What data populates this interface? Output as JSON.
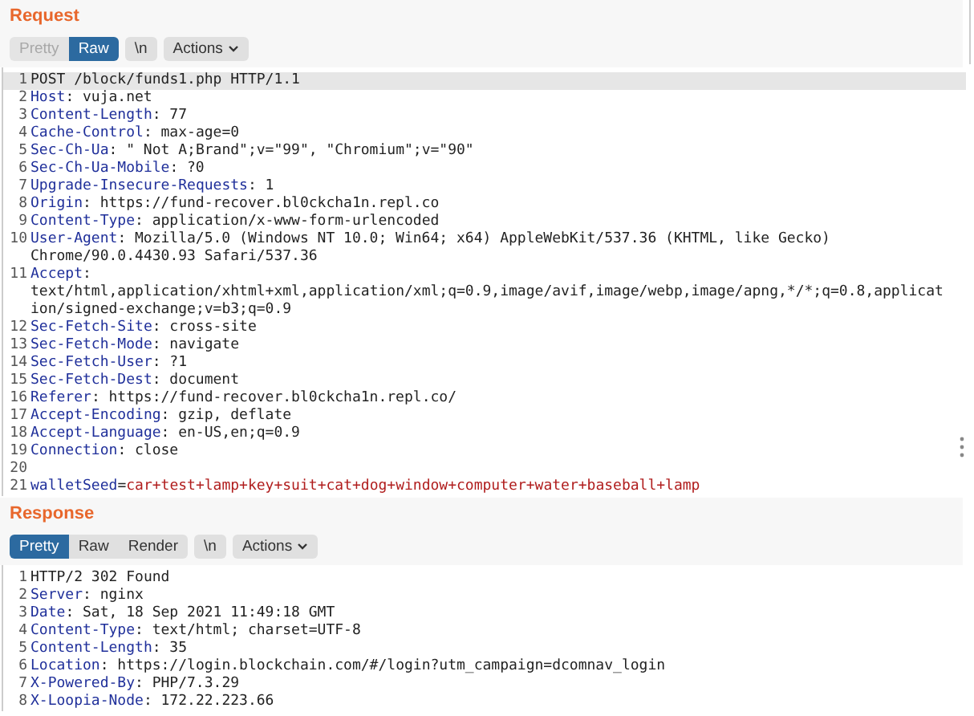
{
  "panels": [
    {
      "title": "Request",
      "tabs": [
        {
          "label": "Pretty",
          "selected": false,
          "disabled": true
        },
        {
          "label": "Raw",
          "selected": true,
          "disabled": false
        }
      ],
      "newline_button": "\\n",
      "actions_button": "Actions",
      "scrollbar": true,
      "lines": [
        {
          "n": "1",
          "kind": "start",
          "text": "POST /block/funds1.php HTTP/1.1",
          "highlighted": true
        },
        {
          "n": "2",
          "kind": "header",
          "name": "Host",
          "separator": ":",
          "value": [
            "vuja.net"
          ],
          "highlighted": false
        },
        {
          "n": "3",
          "kind": "header",
          "name": "Content-Length",
          "separator": ":",
          "value": [
            "77"
          ],
          "highlighted": false
        },
        {
          "n": "4",
          "kind": "header",
          "name": "Cache-Control",
          "separator": ":",
          "value": [
            "max-age=0"
          ],
          "highlighted": false
        },
        {
          "n": "5",
          "kind": "header",
          "name": "Sec-Ch-Ua",
          "separator": ":",
          "value": [
            "\" Not A;Brand\";v=\"99\", \"Chromium\";v=\"90\""
          ],
          "highlighted": false
        },
        {
          "n": "6",
          "kind": "header",
          "name": "Sec-Ch-Ua-Mobile",
          "separator": ":",
          "value": [
            "?0"
          ],
          "highlighted": false
        },
        {
          "n": "7",
          "kind": "header",
          "name": "Upgrade-Insecure-Requests",
          "separator": ":",
          "value": [
            "1"
          ],
          "highlighted": false
        },
        {
          "n": "8",
          "kind": "header",
          "name": "Origin",
          "separator": ":",
          "value": [
            "https://fund-recover.bl0ckcha1n.repl.co"
          ],
          "highlighted": false
        },
        {
          "n": "9",
          "kind": "header",
          "name": "Content-Type",
          "separator": ":",
          "value": [
            "application/x-www-form-urlencoded"
          ],
          "highlighted": false
        },
        {
          "n": "10",
          "kind": "header",
          "name": "User-Agent",
          "separator": ":",
          "value": [
            "Mozilla/5.0 (Windows NT 10.0; Win64; x64) AppleWebKit/537.36 (KHTML, like Gecko)",
            "Chrome/90.0.4430.93 Safari/537.36"
          ],
          "highlighted": false
        },
        {
          "n": "11",
          "kind": "header",
          "name": "Accept",
          "separator": ":",
          "value_on_next_line": true,
          "value": [
            "text/html,application/xhtml+xml,application/xml;q=0.9,image/avif,image/webp,image/apng,*/*;q=0.8,applicat",
            "ion/signed-exchange;v=b3;q=0.9"
          ],
          "highlighted": false
        },
        {
          "n": "12",
          "kind": "header",
          "name": "Sec-Fetch-Site",
          "separator": ":",
          "value": [
            "cross-site"
          ],
          "highlighted": false
        },
        {
          "n": "13",
          "kind": "header",
          "name": "Sec-Fetch-Mode",
          "separator": ":",
          "value": [
            "navigate"
          ],
          "highlighted": false
        },
        {
          "n": "14",
          "kind": "header",
          "name": "Sec-Fetch-User",
          "separator": ":",
          "value": [
            "?1"
          ],
          "highlighted": false
        },
        {
          "n": "15",
          "kind": "header",
          "name": "Sec-Fetch-Dest",
          "separator": ":",
          "value": [
            "document"
          ],
          "highlighted": false
        },
        {
          "n": "16",
          "kind": "header",
          "name": "Referer",
          "separator": ":",
          "value": [
            "https://fund-recover.bl0ckcha1n.repl.co/"
          ],
          "highlighted": false
        },
        {
          "n": "17",
          "kind": "header",
          "name": "Accept-Encoding",
          "separator": ":",
          "value": [
            "gzip, deflate"
          ],
          "highlighted": false
        },
        {
          "n": "18",
          "kind": "header",
          "name": "Accept-Language",
          "separator": ":",
          "value": [
            "en-US,en;q=0.9"
          ],
          "highlighted": false
        },
        {
          "n": "19",
          "kind": "header",
          "name": "Connection",
          "separator": ":",
          "value": [
            "close"
          ],
          "highlighted": false
        },
        {
          "n": "20",
          "kind": "blank",
          "highlighted": false
        },
        {
          "n": "21",
          "kind": "param",
          "name": "walletSeed",
          "separator": "=",
          "value": [
            "car+test+lamp+key+suit+cat+dog+window+computer+water+baseball+lamp"
          ],
          "highlighted": false
        }
      ]
    },
    {
      "title": "Response",
      "tabs": [
        {
          "label": "Pretty",
          "selected": true,
          "disabled": false
        },
        {
          "label": "Raw",
          "selected": false,
          "disabled": false
        },
        {
          "label": "Render",
          "selected": false,
          "disabled": false
        }
      ],
      "newline_button": "\\n",
      "actions_button": "Actions",
      "lines": [
        {
          "n": "1",
          "kind": "start",
          "text": "HTTP/2 302 Found",
          "highlighted": false
        },
        {
          "n": "2",
          "kind": "header",
          "name": "Server",
          "separator": ":",
          "value": [
            "nginx"
          ],
          "highlighted": false
        },
        {
          "n": "3",
          "kind": "header",
          "name": "Date",
          "separator": ":",
          "value": [
            "Sat, 18 Sep 2021 11:49:18 GMT"
          ],
          "highlighted": false
        },
        {
          "n": "4",
          "kind": "header",
          "name": "Content-Type",
          "separator": ":",
          "value": [
            "text/html; charset=UTF-8"
          ],
          "highlighted": false
        },
        {
          "n": "5",
          "kind": "header",
          "name": "Content-Length",
          "separator": ":",
          "value": [
            "35"
          ],
          "highlighted": false
        },
        {
          "n": "6",
          "kind": "header",
          "name": "Location",
          "separator": ":",
          "value": [
            "https://login.blockchain.com/#/login?utm_campaign=dcomnav_login"
          ],
          "highlighted": false
        },
        {
          "n": "7",
          "kind": "header",
          "name": "X-Powered-By",
          "separator": ":",
          "value": [
            "PHP/7.3.29"
          ],
          "highlighted": false
        },
        {
          "n": "8",
          "kind": "header",
          "name": "X-Loopia-Node",
          "separator": ":",
          "value": [
            "172.22.223.66"
          ],
          "highlighted": false
        }
      ]
    }
  ]
}
